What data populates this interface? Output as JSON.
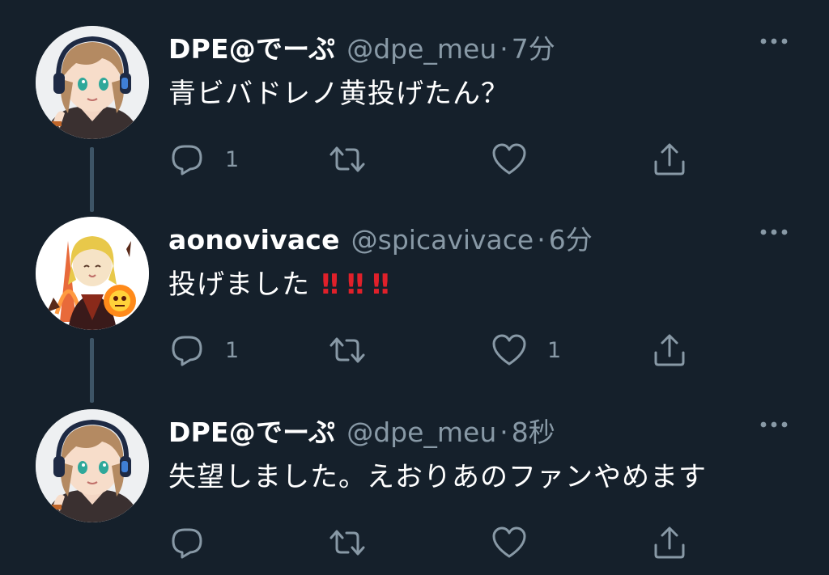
{
  "tweets": [
    {
      "display_name": "DPE@でーぷ",
      "handle": "@dpe_meu",
      "separator": "·",
      "time": "7分",
      "text": "青ビバドレノ黄投げたん？",
      "reply_count": "1",
      "retweet_count": "",
      "like_count": "",
      "avatar_icon": "avatar-headphone-girl"
    },
    {
      "display_name": "aonovivace",
      "handle": "@spicavivace",
      "separator": "·",
      "time": "6分",
      "text": "投げました",
      "emoji": [
        "‼",
        "‼",
        "‼"
      ],
      "reply_count": "1",
      "retweet_count": "",
      "like_count": "1",
      "avatar_icon": "avatar-blonde-warrior"
    },
    {
      "display_name": "DPE@でーぷ",
      "handle": "@dpe_meu",
      "separator": "·",
      "time": "8秒",
      "text": "失望しました。えおりあのファンやめます",
      "reply_count": "",
      "retweet_count": "",
      "like_count": "",
      "avatar_icon": "avatar-headphone-girl"
    }
  ],
  "colors": {
    "background": "#15202b",
    "text_primary": "#ffffff",
    "text_secondary": "#8899a6",
    "thread_line": "#3d5466",
    "emoji_red": "#e0202a"
  },
  "icons": [
    "reply-icon",
    "retweet-icon",
    "like-icon",
    "share-icon",
    "more-icon"
  ]
}
